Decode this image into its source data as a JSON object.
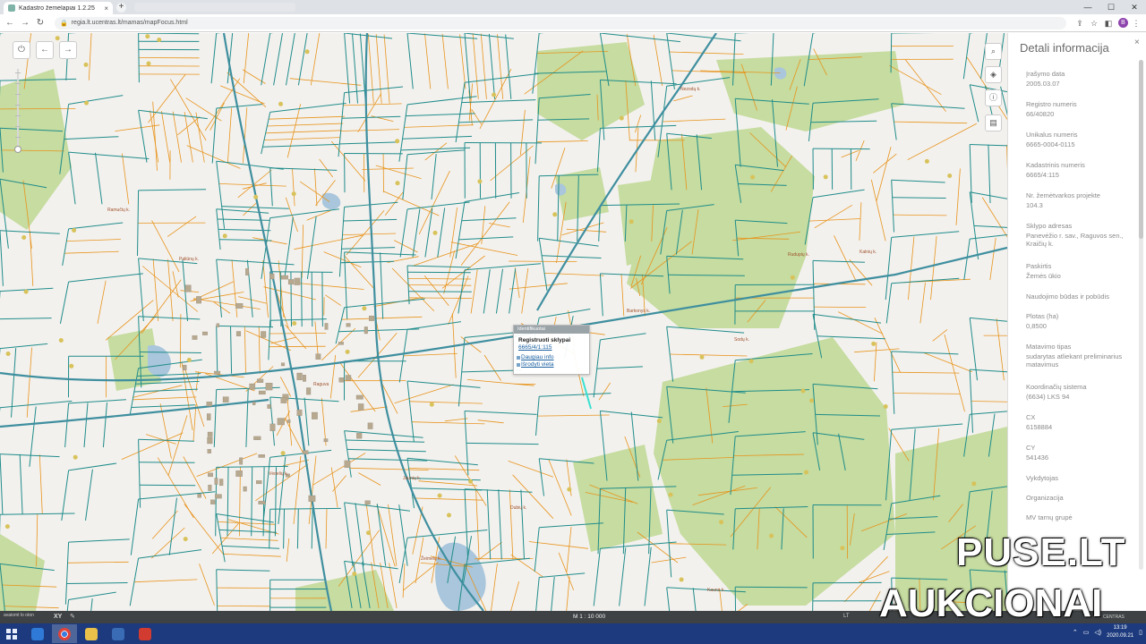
{
  "browser": {
    "tab_title": "Kadastro žemėlapiai 1.2.25",
    "tab_close": "×",
    "new_tab": "+",
    "url": "regia.lt.ucentras.lt/mamas/mapFocus.html",
    "back": "←",
    "forward": "→",
    "reload": "↻",
    "lock": "🔒",
    "profile_initial": "B",
    "minimize": "—",
    "maximize": "☐",
    "close": "✕"
  },
  "map": {
    "power": "⏻",
    "back": "←",
    "forward": "→",
    "search": "⌕",
    "layers": "◈",
    "info": "ⓘ",
    "legend": "▤",
    "place_labels": [
      "Ramučių k.",
      "Nezodų k.",
      "Kalnių k.",
      "Rudupių k.",
      "Jaunių k.",
      "Barkonys k.",
      "Vėdelių k.",
      "Sodų k.",
      "Dubių k.",
      "Kauno k.",
      "Raguva",
      "Paliūnų k.",
      "Žeimelų k."
    ],
    "popup": {
      "header": "Identifikuotai",
      "title": "Registruoti sklypai",
      "number": "6665/4/1:115",
      "link_details": "Daugiau info",
      "link_zoom": "Išrodyti vieta"
    }
  },
  "statusbar": {
    "coords": "avaiomt lo oton",
    "xy": "XY",
    "pencil": "✎",
    "scale": "M 1 : 10 000",
    "lang": "LT",
    "brand": "CENTRAS"
  },
  "panel": {
    "title": "Detali informacija",
    "close": "×",
    "fields": [
      {
        "label": "Įrašymo data",
        "value": "2005.03.07"
      },
      {
        "label": "Registro numeris",
        "value": "66/40820"
      },
      {
        "label": "Unikalus numeris",
        "value": "6665-0004-0115"
      },
      {
        "label": "Kadastrinis numeris",
        "value": "6665/4:115"
      },
      {
        "label": "Nr. žemėtvarkos projekte",
        "value": "104.3"
      },
      {
        "label": "Sklypo adresas",
        "value": "Panevėžio r. sav., Raguvos sen., Kraičių k."
      },
      {
        "label": "Paskirtis",
        "value": "Žemės ūkio"
      },
      {
        "label": "Naudojimo būdas ir pobūdis",
        "value": ""
      },
      {
        "label": "Plotas (ha)",
        "value": "0,8500"
      },
      {
        "label": "Matavimo tipas",
        "value": "sudarytas atliekant preliminarius matavimus"
      },
      {
        "label": "Koordinačių sistema",
        "value": "(6634) LKS 94"
      },
      {
        "label": "CX",
        "value": "6158884"
      },
      {
        "label": "CY",
        "value": "541436"
      },
      {
        "label": "Vykdytojas",
        "value": ""
      },
      {
        "label": "Organizacija",
        "value": ""
      },
      {
        "label": "MV tarnų grupė",
        "value": ""
      }
    ]
  },
  "taskbar": {
    "time": "13:19",
    "date": "2020.09.21",
    "tray_up": "⌃",
    "tray_net": "▭",
    "tray_vol": "◁)",
    "tray_msg": "▯"
  },
  "watermark": {
    "line1": "PUSE.LT",
    "line2": "AUKCIONAI"
  },
  "colors": {
    "parcel_teal": "#1f8c8a",
    "parcel_orange": "#e7941c",
    "forest_green": "#c6dca0",
    "water_blue": "#a9c6dc",
    "taskbar": "#1c3a7d"
  }
}
